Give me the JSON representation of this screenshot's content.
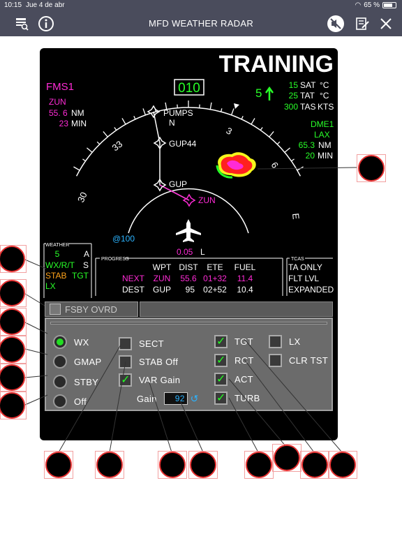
{
  "status_bar": {
    "time": "10:15",
    "date": "Jue 4 de abr",
    "battery": "65 %",
    "battery_level": 0.65
  },
  "nav": {
    "title": "MFD WEATHER RADAR",
    "icons": [
      "search-doc-icon",
      "info-icon",
      "mute-icon",
      "notes-icon",
      "close-icon"
    ]
  },
  "display": {
    "training": "TRAINING",
    "fms": "FMS1",
    "waypoint": {
      "name": "ZUN",
      "dist": "55. 6",
      "dist_unit": "NM",
      "min": "23",
      "min_unit": "MIN"
    },
    "heading": "010",
    "speed_arrow": "5",
    "temps": [
      {
        "value": "15",
        "label": "SAT",
        "unit": "°C"
      },
      {
        "value": "25",
        "label": "TAT",
        "unit": "°C"
      },
      {
        "value": "300",
        "label": "TAS",
        "unit": "KTS"
      }
    ],
    "dme": {
      "label": "DME1",
      "station": "LAX",
      "dist": "65.3",
      "dist_unit": "NM",
      "min": "20",
      "min_unit": "MIN"
    },
    "compass": [
      "N",
      "3",
      "6",
      "E",
      "30",
      "33"
    ],
    "fixes": [
      "PUMPS",
      "GUP44",
      "GUP",
      "ZUN"
    ],
    "range": "100",
    "range_inner": "0.05",
    "range_inner_suffix": "L",
    "weather": {
      "label": "WEATHER",
      "row1_val": "5",
      "row1_mode": "A",
      "row2": "WX/R/T",
      "row2_mode": "S",
      "row3": "STAB",
      "row3_tgt": "TGT",
      "row4": "LX"
    },
    "progress": {
      "label": "PROGRESS",
      "headers": [
        "WPT",
        "DIST",
        "ETE",
        "FUEL"
      ],
      "rows": [
        {
          "label": "NEXT",
          "wpt": "ZUN",
          "dist": "55.6",
          "ete": "01+32",
          "fuel": "11.4"
        },
        {
          "label": "DEST",
          "wpt": "GUP",
          "dist": "95",
          "ete": "02+52",
          "fuel": "10.4"
        }
      ]
    },
    "tcas": {
      "label": "TCAS",
      "lines": [
        "TA ONLY",
        "FLT LVL",
        "EXPANDED"
      ]
    },
    "colors": {
      "magenta": "#ff2bd6",
      "green": "#28ff28",
      "cyan": "#2bb3ff",
      "amber": "#ffa31a"
    }
  },
  "controls": {
    "fsby": "FSBY OVRD",
    "modes": [
      {
        "label": "WX",
        "selected": true
      },
      {
        "label": "GMAP",
        "selected": false
      },
      {
        "label": "STBY",
        "selected": false
      },
      {
        "label": "Off",
        "selected": false
      }
    ],
    "checks_mid": [
      {
        "label": "SECT",
        "checked": false
      },
      {
        "label": "STAB Off",
        "checked": false
      },
      {
        "label": "VAR Gain",
        "checked": true
      }
    ],
    "gain_label": "Gain",
    "gain_value": "92",
    "checks_right": [
      {
        "label": "TGT",
        "checked": true
      },
      {
        "label": "RCT",
        "checked": true
      },
      {
        "label": "ACT",
        "checked": true
      },
      {
        "label": "TURB",
        "checked": true
      }
    ],
    "checks_far": [
      {
        "label": "LX",
        "checked": false
      },
      {
        "label": "CLR TST",
        "checked": false
      }
    ]
  }
}
